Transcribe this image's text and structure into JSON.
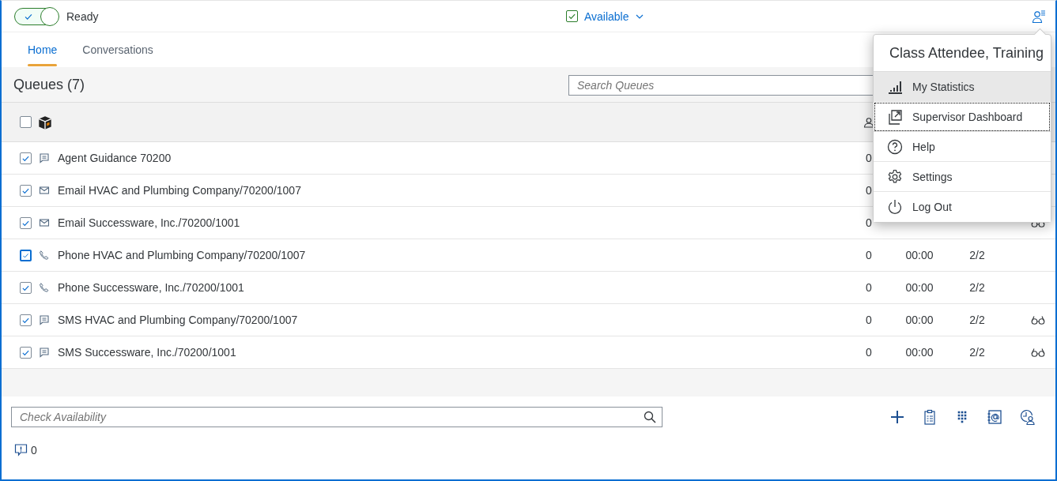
{
  "status_toggle": {
    "on": true,
    "label": "Ready"
  },
  "availability": {
    "checked": true,
    "label": "Available"
  },
  "tabs": [
    {
      "label": "Home",
      "selected": true
    },
    {
      "label": "Conversations",
      "selected": false
    }
  ],
  "queues": {
    "title": "Queues (7)",
    "search": {
      "placeholder": "Search Queues"
    },
    "select_all": {
      "checked": false
    },
    "rows": [
      {
        "kind": "chat",
        "checked": true,
        "focused": false,
        "name": "Agent Guidance 70200",
        "waiting": "0",
        "monitored": false
      },
      {
        "kind": "email",
        "checked": true,
        "focused": false,
        "name": "Email HVAC and Plumbing Company/70200/1007",
        "waiting": "0",
        "monitored": false
      },
      {
        "kind": "email",
        "checked": true,
        "focused": false,
        "name": "Email Successware, Inc./70200/1001",
        "waiting": "0",
        "monitored": true
      },
      {
        "kind": "phone",
        "checked": true,
        "focused": true,
        "name": "Phone HVAC and Plumbing Company/70200/1007",
        "waiting": "0",
        "time": "00:00",
        "agents": "2/2",
        "monitored": false
      },
      {
        "kind": "phone",
        "checked": true,
        "focused": false,
        "name": "Phone Successware, Inc./70200/1001",
        "waiting": "0",
        "time": "00:00",
        "agents": "2/2",
        "monitored": false
      },
      {
        "kind": "chat",
        "checked": true,
        "focused": false,
        "name": "SMS HVAC and Plumbing Company/70200/1007",
        "waiting": "0",
        "time": "00:00",
        "agents": "2/2",
        "monitored": true
      },
      {
        "kind": "chat",
        "checked": true,
        "focused": false,
        "name": "SMS Successware, Inc./70200/1001",
        "waiting": "0",
        "time": "00:00",
        "agents": "2/2",
        "monitored": true
      }
    ]
  },
  "check_availability": {
    "placeholder": "Check Availability"
  },
  "notifications": {
    "count": "0"
  },
  "user_menu": {
    "title": "Class Attendee, Training",
    "items": [
      {
        "kind": "statistics",
        "label": "My Statistics",
        "hovered": true,
        "focused": false
      },
      {
        "kind": "dashboard",
        "label": "Supervisor Dashboard",
        "hovered": false,
        "focused": true
      },
      {
        "kind": "help",
        "label": "Help",
        "hovered": false,
        "focused": false
      },
      {
        "kind": "settings",
        "label": "Settings",
        "hovered": false,
        "focused": false
      },
      {
        "kind": "logout",
        "label": "Log Out",
        "hovered": false,
        "focused": false
      }
    ]
  }
}
